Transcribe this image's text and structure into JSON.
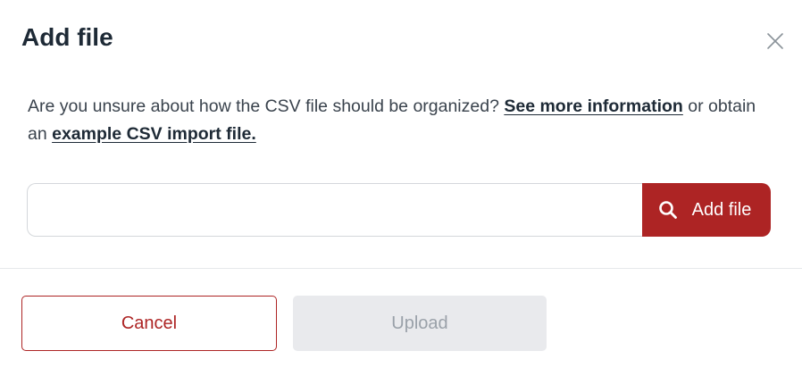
{
  "dialog": {
    "title": "Add file",
    "close_icon": "close-icon"
  },
  "info": {
    "text_before": "Are you unsure about how the CSV file should be organized? ",
    "link_more_info": "See more information",
    "text_middle": " or obtain an ",
    "link_example": "example CSV import file."
  },
  "file_picker": {
    "value": "",
    "button_label": "Add file",
    "button_icon": "search-icon"
  },
  "footer": {
    "cancel_label": "Cancel",
    "upload_label": "Upload"
  },
  "colors": {
    "accent": "#ad2424",
    "title": "#1e2a36",
    "disabled_bg": "#e9eaed",
    "disabled_text": "#9aa1a9"
  }
}
